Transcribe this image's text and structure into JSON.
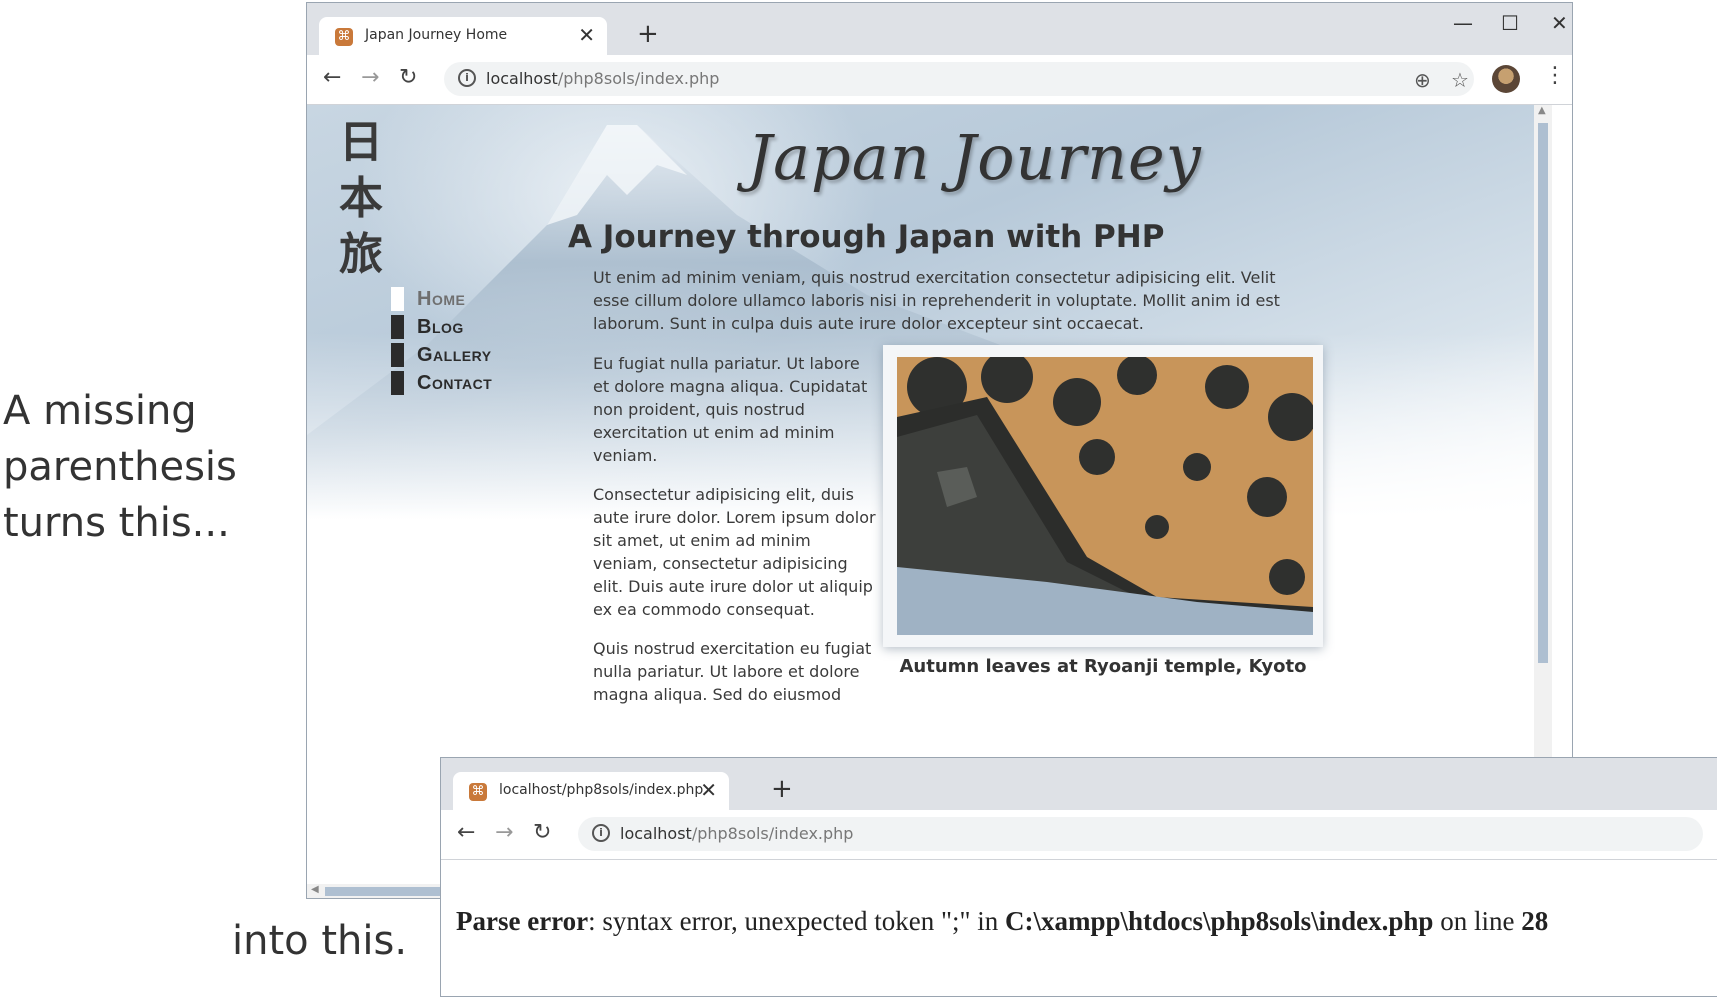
{
  "captions": {
    "top": "A missing parenthesis turns this...",
    "bottom": "into this."
  },
  "window1": {
    "tab_title": "Japan Journey Home",
    "tab_close": "✕",
    "new_tab": "+",
    "controls": {
      "minimize": "—",
      "maximize": "☐",
      "close": "✕"
    },
    "nav": {
      "back": "←",
      "forward": "→",
      "reload": "↻"
    },
    "url_host": "localhost",
    "url_path": "/php8sols/index.php",
    "zoom_icon": "⊕",
    "bookmark_icon": "☆",
    "menu_icon": "⋮",
    "page": {
      "kanji": [
        "日",
        "本",
        "旅"
      ],
      "site_title": "Japan Journey",
      "heading": "A Journey through Japan with PHP",
      "nav_items": [
        {
          "label": "Home",
          "active": true
        },
        {
          "label": "Blog",
          "active": false
        },
        {
          "label": "Gallery",
          "active": false
        },
        {
          "label": "Contact",
          "active": false
        }
      ],
      "paragraph1": "Ut enim ad minim veniam, quis nostrud exercitation consectetur adipisicing elit. Velit esse cillum dolore ullamco laboris nisi in reprehenderit in voluptate. Mollit anim id est laborum. Sunt in culpa duis aute irure dolor excepteur sint occaecat.",
      "paragraph2": "Eu fugiat nulla pariatur. Ut labore et dolore magna aliqua. Cupidatat non proident, quis nostrud exercitation ut enim ad minim veniam.",
      "paragraph3": "Consectetur adipisicing elit, duis aute irure dolor. Lorem ipsum dolor sit amet, ut enim ad minim veniam, consectetur adipisicing elit. Duis aute irure dolor ut aliquip ex ea commodo consequat.",
      "paragraph4": "Quis nostrud exercitation eu fugiat nulla pariatur. Ut labore et dolore magna aliqua. Sed do eiusmod",
      "figure_caption": "Autumn leaves at Ryoanji temple, Kyoto"
    }
  },
  "window2": {
    "tab_title": "localhost/php8sols/index.php",
    "tab_close": "✕",
    "new_tab": "+",
    "nav": {
      "back": "←",
      "forward": "→",
      "reload": "↻"
    },
    "url_host": "localhost",
    "url_path": "/php8sols/index.php",
    "error": {
      "label": "Parse error",
      "message": ": syntax error, unexpected token \";\" in ",
      "file": "C:\\xampp\\htdocs\\php8sols\\index.php",
      "on_line": " on line ",
      "line": "28"
    }
  },
  "colors": {
    "tabbar": "#dee1e6",
    "favicon": "#c9793a",
    "nav_bar": "#2b2b2b",
    "scroll_thumb": "#aebfd1"
  }
}
